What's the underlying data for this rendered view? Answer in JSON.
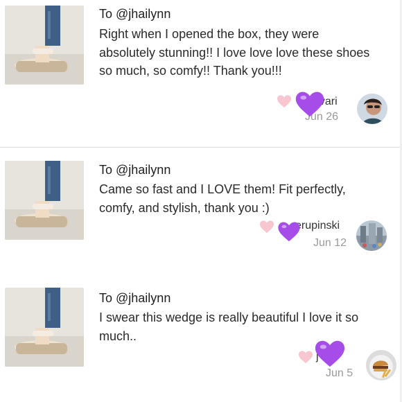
{
  "reviews": [
    {
      "to": "To @jhailynn",
      "text": "Right when I opened the box, they were absolutely stunning!! I love love love these shoes so much, so comfy!! Thank you!!!",
      "user": "_vari",
      "date": "Jun 26"
    },
    {
      "to": "To @jhailynn",
      "text": "Came so fast and I LOVE them! Fit perfectly, comfy, and stylish, thank you :)",
      "user": "erupinski",
      "date": "Jun 12"
    },
    {
      "to": "To @jhailynn",
      "text": "I swear this wedge is really beautiful I love it so much..",
      "user": "j    err",
      "date": "Jun 5"
    }
  ],
  "icons": {
    "like": "heart-icon",
    "sticker": "purple-heart-emoji"
  },
  "colors": {
    "like_heart": "#f7c6cf",
    "purple_heart": "#a64ce8",
    "date": "#9a9a9a"
  }
}
